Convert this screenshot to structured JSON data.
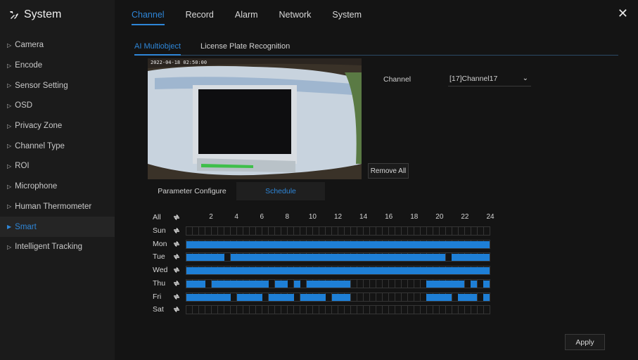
{
  "app": {
    "title": "System"
  },
  "sidebar": {
    "items": [
      {
        "label": "Camera"
      },
      {
        "label": "Encode"
      },
      {
        "label": "Sensor Setting"
      },
      {
        "label": "OSD"
      },
      {
        "label": "Privacy Zone"
      },
      {
        "label": "Channel Type"
      },
      {
        "label": "ROI"
      },
      {
        "label": "Microphone"
      },
      {
        "label": "Human Thermometer"
      },
      {
        "label": "Smart"
      },
      {
        "label": "Intelligent Tracking"
      }
    ],
    "active_index": 9
  },
  "top_tabs": [
    {
      "label": "Channel"
    },
    {
      "label": "Record"
    },
    {
      "label": "Alarm"
    },
    {
      "label": "Network"
    },
    {
      "label": "System"
    }
  ],
  "sub_tabs": [
    {
      "label": "AI Multiobject"
    },
    {
      "label": "License Plate Recognition"
    }
  ],
  "preview": {
    "timestamp": "2022-04-18 02:50:00"
  },
  "channel": {
    "label": "Channel",
    "value": "[17]Channel17"
  },
  "buttons": {
    "remove_all": "Remove All",
    "apply": "Apply"
  },
  "config_tabs": [
    {
      "label": "Parameter Configure"
    },
    {
      "label": "Schedule"
    }
  ],
  "schedule": {
    "all_label": "All",
    "hour_labels": [
      "2",
      "4",
      "6",
      "8",
      "10",
      "12",
      "14",
      "16",
      "18",
      "20",
      "22",
      "24"
    ],
    "days": [
      {
        "label": "Sun",
        "segments": []
      },
      {
        "label": "Mon",
        "segments": [
          [
            0,
            24
          ]
        ]
      },
      {
        "label": "Tue",
        "segments": [
          [
            0,
            3
          ],
          [
            3.5,
            20.5
          ],
          [
            21,
            24
          ]
        ]
      },
      {
        "label": "Wed",
        "segments": [
          [
            0,
            23
          ],
          [
            23,
            24
          ]
        ]
      },
      {
        "label": "Thu",
        "segments": [
          [
            0,
            1.5
          ],
          [
            2,
            6.5
          ],
          [
            7,
            8
          ],
          [
            8.5,
            9
          ],
          [
            9.5,
            13
          ],
          [
            19,
            22
          ],
          [
            22.5,
            23
          ],
          [
            23.5,
            24
          ]
        ]
      },
      {
        "label": "Fri",
        "segments": [
          [
            0,
            3.5
          ],
          [
            4,
            6
          ],
          [
            6.5,
            8.5
          ],
          [
            9,
            11
          ],
          [
            11.5,
            13
          ],
          [
            19,
            21
          ],
          [
            21.5,
            23
          ],
          [
            23.5,
            24
          ]
        ]
      },
      {
        "label": "Sat",
        "segments": []
      }
    ]
  },
  "colors": {
    "accent": "#2e86d8",
    "segment": "#1e7fd6",
    "background": "#141414"
  },
  "icons": {
    "brand": "tools-icon",
    "close": "close-icon",
    "sync": "sync-icon",
    "dropdown": "chevron-down-icon"
  }
}
